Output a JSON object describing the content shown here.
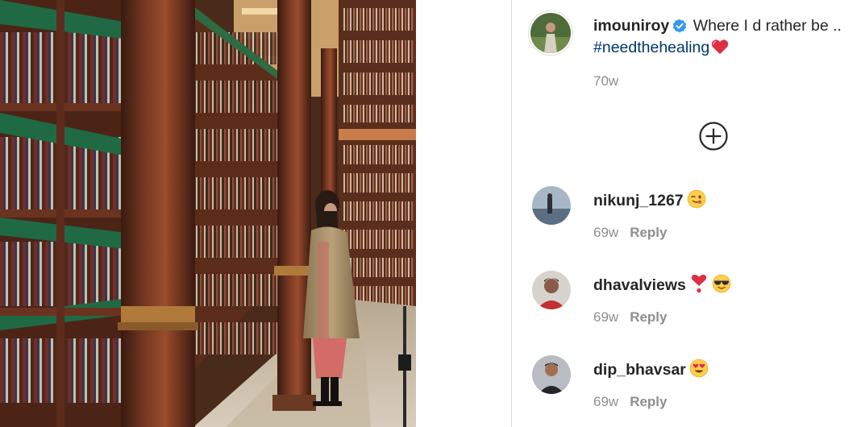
{
  "post": {
    "owner_username": "imouniroy",
    "verified": true,
    "caption_text": "Where I d rather be ..",
    "hashtag": "#needthehealing",
    "caption_emoji": "red-heart-emoji",
    "time_ago": "70w"
  },
  "add_comment": {
    "icon": "plus-circle-icon"
  },
  "comments": [
    {
      "username": "nikunj_1267",
      "emoji": [
        "winking-face-with-tongue-emoji"
      ],
      "time_ago": "69w",
      "reply_label": "Reply"
    },
    {
      "username": "dhavalviews",
      "emoji": [
        "heart-exclamation-emoji",
        "smiling-face-with-sunglasses-emoji"
      ],
      "time_ago": "69w",
      "reply_label": "Reply"
    },
    {
      "username": "dip_bhavsar",
      "emoji": [
        "heart-eyes-emoji"
      ],
      "time_ago": "69w",
      "reply_label": "Reply"
    }
  ],
  "colors": {
    "verified_badge": "#3897f0",
    "hashtag": "#00376b",
    "secondary_text": "#8e8e8e",
    "heart": "#ed4956"
  }
}
